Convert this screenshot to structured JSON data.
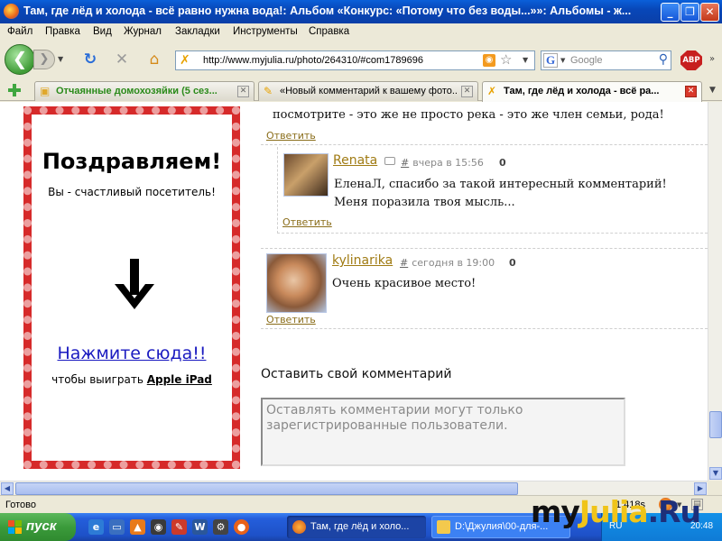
{
  "window": {
    "title": "Там, где лёд и холода - всё равно нужна вода!: Альбом «Конкурс: «Потому что без воды...»»: Альбомы - ж..."
  },
  "menu": [
    "Файл",
    "Правка",
    "Вид",
    "Журнал",
    "Закладки",
    "Инструменты",
    "Справка"
  ],
  "navbar": {
    "url": "http://www.myjulia.ru/photo/264310/#com1789696",
    "search_placeholder": "Google",
    "search_engine": "G",
    "adblock": "ABP"
  },
  "tabs": [
    {
      "label": "Отчаянные домохозяйки (5 сез...",
      "active": false,
      "color": "#2a8a1a"
    },
    {
      "label": "«Новый комментарий к вашему фото...",
      "active": false,
      "color": "#000000"
    },
    {
      "label": "Там, где лёд и холода - всё ра...",
      "active": true,
      "color": "#000000"
    }
  ],
  "ad": {
    "title": "Поздравляем!",
    "subtitle": "Вы - счастливый посетитель!",
    "link": "Нажмите сюда!!",
    "cta_prefix": "чтобы выиграть ",
    "cta_prize": "Apple iPad"
  },
  "comments": {
    "previous_text": "посмотрите - это же не просто река - это же член семьи, рода!",
    "previous_reply": "Ответить",
    "items": [
      {
        "author": "Renata",
        "hash": "#",
        "time": "вчера в 15:56",
        "count": "0",
        "text_line1": "ЕленаЛ, спасибо за такой интересный комментарий!",
        "text_line2": "Меня поразила твоя мысль...",
        "reply": "Ответить"
      },
      {
        "author": "kylinarika",
        "hash": "#",
        "time": "сегодня в 19:00",
        "count": "0",
        "text_line1": "Очень красивое место!",
        "reply": "Ответить"
      }
    ]
  },
  "leave_comment": {
    "title": "Оставить свой комментарий",
    "placeholder": "Оставлять комментарии могут только зарегистрированные пользователи."
  },
  "statusbar": {
    "status": "Готово",
    "timer": "1.418s"
  },
  "taskbar": {
    "start": "пуск",
    "tasks": [
      {
        "label": "Там, где лёд и холо...",
        "active": true
      },
      {
        "label": "D:\\Джулия\\00-для-...",
        "active": false
      }
    ],
    "lang": "RU",
    "clock": "20:48"
  },
  "watermark": {
    "a": "my",
    "b": "Julia",
    "c": ".Ru"
  },
  "colors": {
    "accent": "#0a5fd9",
    "ad_border": "#d62a2a",
    "author_link": "#a07b13",
    "reply_link": "#8a6d1a"
  }
}
